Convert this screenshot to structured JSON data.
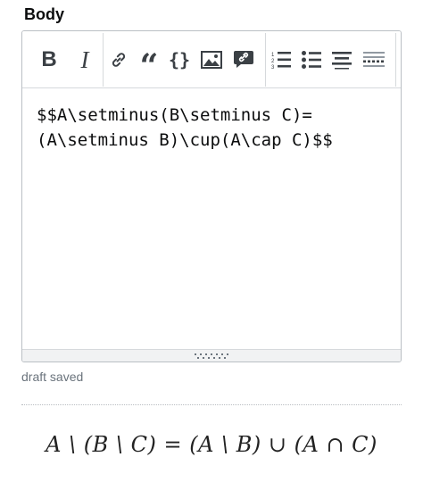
{
  "field": {
    "label": "Body"
  },
  "toolbar": {
    "buttons": [
      {
        "name": "bold",
        "glyph": "B"
      },
      {
        "name": "italic",
        "glyph": "I"
      },
      {
        "name": "link"
      },
      {
        "name": "blockquote",
        "glyph": "“"
      },
      {
        "name": "code",
        "glyph": "{}"
      },
      {
        "name": "image"
      },
      {
        "name": "snippet"
      },
      {
        "name": "numbered-list"
      },
      {
        "name": "bulleted-list"
      },
      {
        "name": "heading"
      },
      {
        "name": "horizontal-rule"
      }
    ]
  },
  "editor": {
    "content": "$$A\\setminus(B\\setminus C)=\n(A\\setminus B)\\cup(A\\cap C)$$"
  },
  "status": {
    "text": "draft saved"
  },
  "preview": {
    "rendered": "A \\ (B \\ C) = (A \\ B) ∪ (A ∩ C)"
  }
}
